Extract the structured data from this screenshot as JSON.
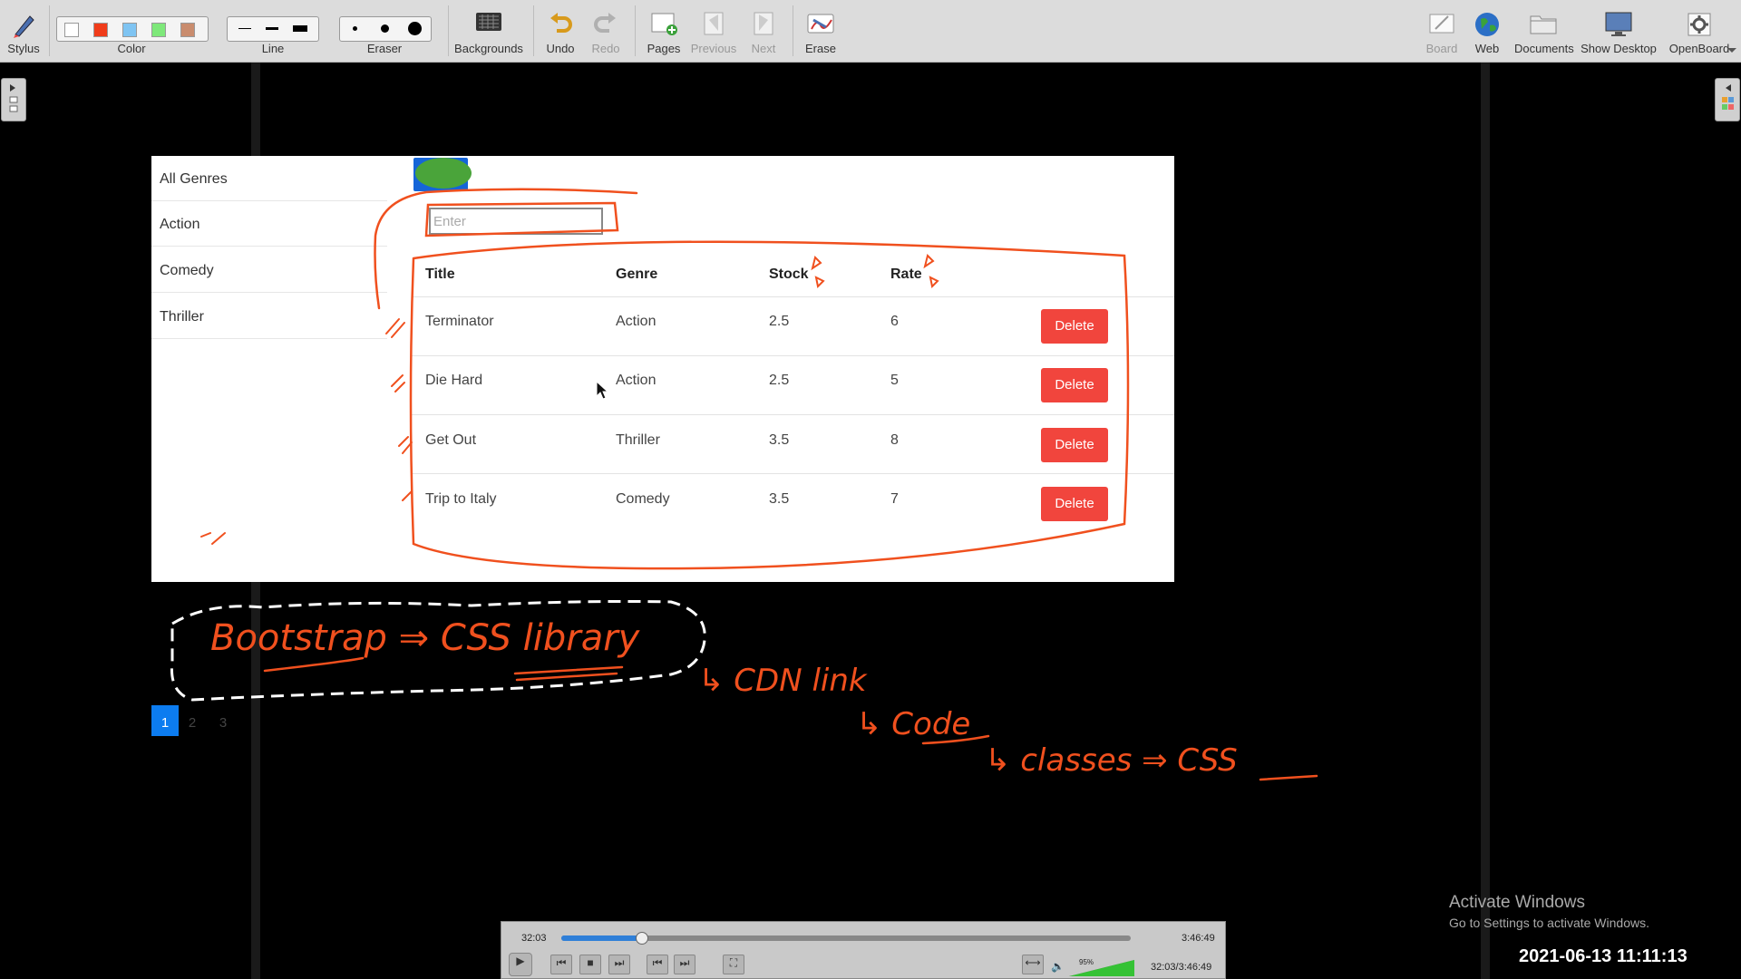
{
  "toolbar": {
    "stylus": "Stylus",
    "color": "Color",
    "line": "Line",
    "eraser": "Eraser",
    "backgrounds": "Backgrounds",
    "undo": "Undo",
    "redo": "Redo",
    "pages": "Pages",
    "previous": "Previous",
    "next": "Next",
    "erase": "Erase",
    "board": "Board",
    "web": "Web",
    "documents": "Documents",
    "show_desktop": "Show Desktop",
    "openboard": "OpenBoard",
    "colors": [
      "#ffffff",
      "#f03c1a",
      "#7fc4f2",
      "#7ee87a",
      "#c98c6e"
    ]
  },
  "app": {
    "genres": [
      "All Genres",
      "Action",
      "Comedy",
      "Thriller"
    ],
    "search_placeholder": "Enter",
    "columns": [
      "Title",
      "Genre",
      "Stock",
      "Rate"
    ],
    "movies": [
      {
        "title": "Terminator",
        "genre": "Action",
        "stock": "2.5",
        "rate": "6",
        "action": "Delete"
      },
      {
        "title": "Die Hard",
        "genre": "Action",
        "stock": "2.5",
        "rate": "5",
        "action": "Delete"
      },
      {
        "title": "Get Out",
        "genre": "Thriller",
        "stock": "3.5",
        "rate": "8",
        "action": "Delete"
      },
      {
        "title": "Trip to Italy",
        "genre": "Comedy",
        "stock": "3.5",
        "rate": "7",
        "action": "Delete"
      }
    ],
    "pages": [
      "1",
      "2",
      "3"
    ],
    "active_page": "1",
    "delete_color": "#f1453d",
    "active_color": "#0c7cf0"
  },
  "annotations": {
    "line1": "Bootstrap ⇒ CSS library",
    "line2": "↳ CDN link",
    "line3": "↳ Code",
    "line4": "↳ classes ⇒ CSS",
    "ink_color": "#f0501e"
  },
  "activation": {
    "title": "Activate Windows",
    "subtitle": "Go to Settings to activate Windows."
  },
  "datetime": "2021-06-13 11:11:13",
  "player": {
    "elapsed": "32:03",
    "total": "3:46:49",
    "position": "32:03/3:46:49",
    "volume": "95%",
    "progress": 0.14
  }
}
